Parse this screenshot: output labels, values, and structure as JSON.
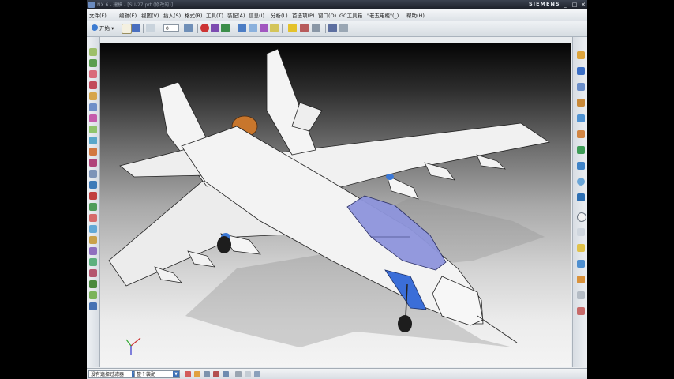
{
  "window": {
    "title": "NX 6 - 建模 - [SU-27.prt (修改的)]",
    "brand": "SIEMENS",
    "controls": {
      "minimize": "_",
      "restore": "□",
      "close": "✕"
    }
  },
  "menu": [
    {
      "label": "文件(F)"
    },
    {
      "label": "编辑(E)"
    },
    {
      "label": "视图(V)"
    },
    {
      "label": "插入(S)"
    },
    {
      "label": "格式(R)"
    },
    {
      "label": "工具(T)"
    },
    {
      "label": "装配(A)"
    },
    {
      "label": "信息(I)"
    },
    {
      "label": "分析(L)"
    },
    {
      "label": "首选项(P)"
    },
    {
      "label": "窗口(O)"
    },
    {
      "label": "GC工具箱"
    },
    {
      "label": "\"老五电柜\"(_)"
    },
    {
      "label": "帮助(H)"
    }
  ],
  "toolbar": {
    "start_label": "开始",
    "undo_count": "0"
  },
  "status": {
    "filter_value": "没有选择过滤器",
    "assembly_value": "整个装配"
  },
  "icons": {
    "left": [
      "sketch-icon",
      "extrude-icon",
      "revolve-icon",
      "hole-icon",
      "boss-icon",
      "pocket-icon",
      "pad-icon",
      "block-icon",
      "cylinder-icon",
      "cone-icon",
      "sphere-icon",
      "datum-plane-icon",
      "datum-axis-icon",
      "point-icon",
      "unite-icon",
      "subtract-icon",
      "intersect-icon",
      "blend-icon",
      "chamfer-icon",
      "shell-icon",
      "trim-body-icon",
      "pattern-icon",
      "mirror-icon",
      "offset-face-icon",
      "draft-icon",
      "thicken-icon",
      "sew-icon",
      "info-icon"
    ],
    "right": [
      "assembly-navigator-icon",
      "constraint-navigator-icon",
      "part-navigator-icon",
      "reuse-library-icon",
      "hd3d-tools-icon",
      "web-browser-icon",
      "history-icon",
      "system-materials-icon",
      "process-studio-icon",
      "manufacturing-wizard-icon",
      "roles-icon",
      "system-scene-icon",
      "palette-icon",
      "clock-icon",
      "layers-icon",
      "visualization-icon",
      "render-icon",
      "camera-icon",
      "measure-icon",
      "section-icon"
    ]
  }
}
